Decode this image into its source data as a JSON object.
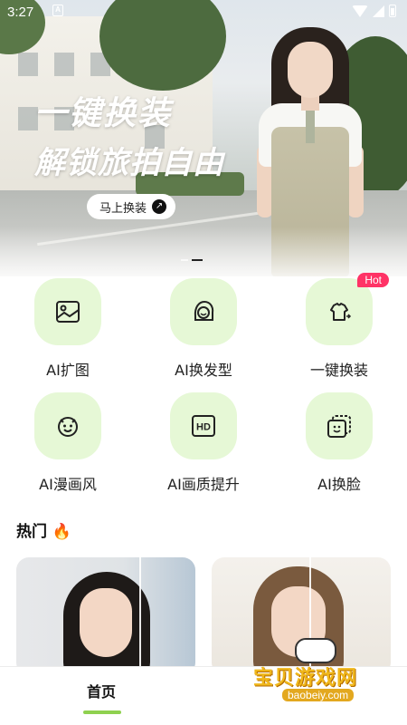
{
  "status_bar": {
    "time": "3:27",
    "notification_badge": "A"
  },
  "banner": {
    "headline_line1": "一键换装",
    "headline_line2": "解锁旅拍自由",
    "cta_label": "马上换装",
    "carousel_count": 2,
    "carousel_active": 2
  },
  "features": [
    {
      "label": "AI扩图",
      "icon": "image-icon"
    },
    {
      "label": "AI换发型",
      "icon": "hairstyle-icon"
    },
    {
      "label": "一键换装",
      "icon": "outfit-icon",
      "badge": "Hot"
    },
    {
      "label": "AI漫画风",
      "icon": "cartoon-face-icon"
    },
    {
      "label": "AI画质提升",
      "icon": "hd-icon"
    },
    {
      "label": "AI换脸",
      "icon": "face-swap-icon"
    }
  ],
  "hot_section": {
    "title": "热门"
  },
  "bottom_nav": {
    "home_label": "首页"
  },
  "watermark": {
    "title": "宝贝游戏网",
    "url": "baobeiy.com"
  },
  "colors": {
    "accent": "#8fd14f",
    "tile_bg": "#e6f8d6",
    "hot_badge": "#ff3366"
  }
}
